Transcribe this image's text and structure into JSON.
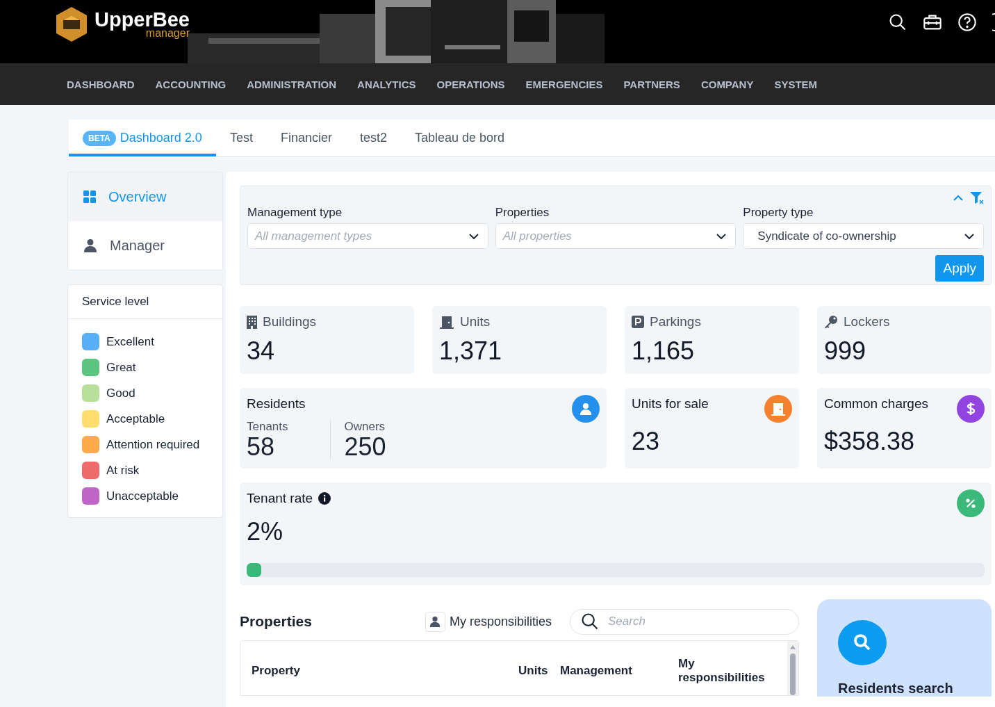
{
  "header": {
    "logo": {
      "name": "UpperBee",
      "subtitle": "manager"
    }
  },
  "nav": [
    "DASHBOARD",
    "ACCOUNTING",
    "ADMINISTRATION",
    "ANALYTICS",
    "OPERATIONS",
    "EMERGENCIES",
    "PARTNERS",
    "COMPANY",
    "SYSTEM"
  ],
  "tabs": [
    {
      "label": "Dashboard 2.0",
      "badge": "BETA",
      "selected": true
    },
    {
      "label": "Test",
      "selected": false
    },
    {
      "label": "Financier",
      "selected": false
    },
    {
      "label": "test2",
      "selected": false
    },
    {
      "label": "Tableau de bord",
      "selected": false
    }
  ],
  "sidebar": {
    "items": [
      {
        "label": "Overview",
        "selected": true
      },
      {
        "label": "Manager",
        "selected": false
      }
    ],
    "service_level": {
      "title": "Service level",
      "items": [
        {
          "label": "Excellent",
          "color": "#5ab0f6"
        },
        {
          "label": "Great",
          "color": "#5bc67f"
        },
        {
          "label": "Good",
          "color": "#b9e09a"
        },
        {
          "label": "Acceptable",
          "color": "#ffdd6e"
        },
        {
          "label": "Attention required",
          "color": "#ffab4a"
        },
        {
          "label": "At risk",
          "color": "#ee6b6b"
        },
        {
          "label": "Unacceptable",
          "color": "#c066c9"
        }
      ]
    }
  },
  "filters": {
    "fields": [
      {
        "label": "Management type",
        "placeholder": "All management types"
      },
      {
        "label": "Properties",
        "placeholder": "All properties"
      },
      {
        "label": "Property type",
        "value": "Syndicate of co-ownership"
      }
    ],
    "apply": "Apply"
  },
  "stats": [
    {
      "label": "Buildings",
      "value": "34"
    },
    {
      "label": "Units",
      "value": "1,371"
    },
    {
      "label": "Parkings",
      "value": "1,165"
    },
    {
      "label": "Lockers",
      "value": "999"
    }
  ],
  "residents": {
    "title": "Residents",
    "parts": [
      {
        "label": "Tenants",
        "value": "58"
      },
      {
        "label": "Owners",
        "value": "250"
      }
    ]
  },
  "cards": [
    {
      "title": "Units for sale",
      "value": "23",
      "color": "#f5812f"
    },
    {
      "title": "Common charges",
      "value": "$358.38",
      "color": "#9244e0"
    }
  ],
  "tenant_rate": {
    "title": "Tenant rate",
    "value": "2%",
    "level": 0.02
  },
  "properties": {
    "title": "Properties",
    "filter": "My responsibilities",
    "search_placeholder": "Search",
    "columns": [
      "Property",
      "Units",
      "Management",
      "My responsibilities"
    ]
  },
  "residents_search": {
    "title": "Residents search"
  }
}
